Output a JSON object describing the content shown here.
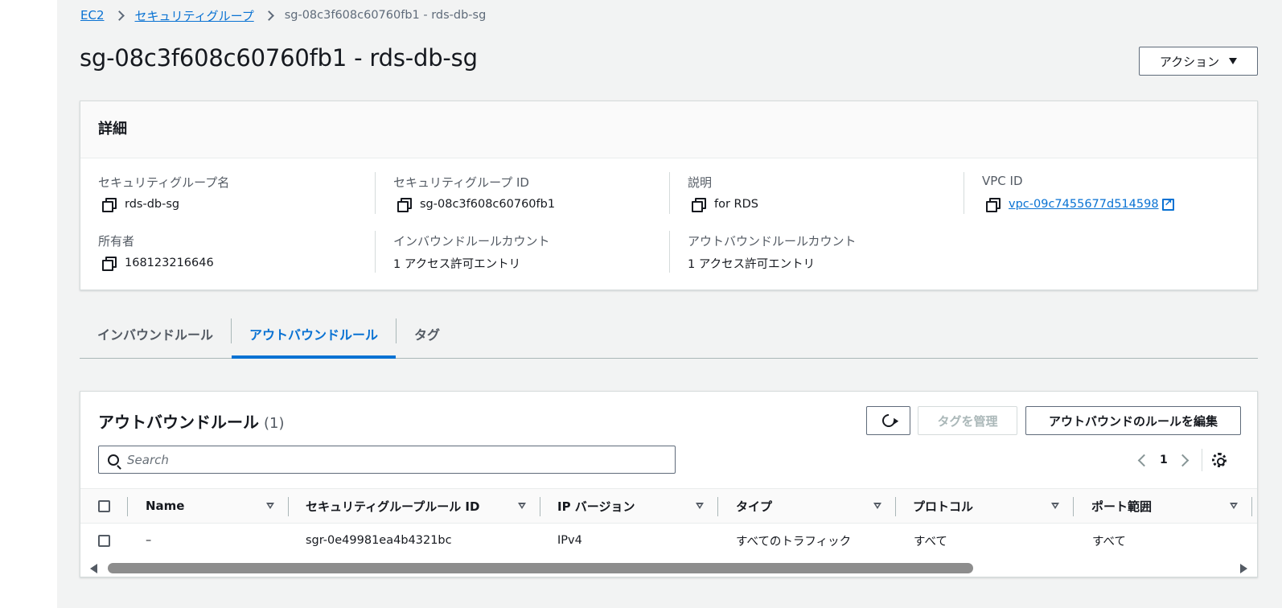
{
  "breadcrumb": {
    "items": [
      "EC2",
      "セキュリティグループ"
    ],
    "current": "sg-08c3f608c60760fb1 - rds-db-sg"
  },
  "page": {
    "title": "sg-08c3f608c60760fb1 - rds-db-sg",
    "actions_label": "アクション"
  },
  "details": {
    "header": "詳細",
    "fields": {
      "sg_name": {
        "label": "セキュリティグループ名",
        "value": "rds-db-sg"
      },
      "sg_id": {
        "label": "セキュリティグループ ID",
        "value": "sg-08c3f608c60760fb1"
      },
      "description": {
        "label": "説明",
        "value": "for RDS"
      },
      "vpc_id": {
        "label": "VPC ID",
        "value": "vpc-09c7455677d514598"
      },
      "owner": {
        "label": "所有者",
        "value": "168123216646"
      },
      "inbound_count": {
        "label": "インバウンドルールカウント",
        "value": "1 アクセス許可エントリ"
      },
      "outbound_count": {
        "label": "アウトバウンドルールカウント",
        "value": "1 アクセス許可エントリ"
      }
    }
  },
  "tabs": [
    {
      "label": "インバウンドルール",
      "active": false
    },
    {
      "label": "アウトバウンドルール",
      "active": true
    },
    {
      "label": "タグ",
      "active": false
    }
  ],
  "rules": {
    "title": "アウトバウンドルール",
    "count": "(1)",
    "manage_tags_label": "タグを管理",
    "edit_label": "アウトバウンドのルールを編集",
    "search_placeholder": "Search",
    "page_number": "1",
    "columns": [
      "Name",
      "セキュリティグループルール ID",
      "IP バージョン",
      "タイプ",
      "プロトコル",
      "ポート範囲"
    ],
    "rows": [
      [
        "–",
        "sgr-0e49981ea4b4321bc",
        "IPv4",
        "すべてのトラフィック",
        "すべて",
        "すべて"
      ]
    ]
  },
  "colors": {
    "link": "#0972d3",
    "background": "#f2f3f3",
    "active_tab": "#0972d3"
  },
  "icons": [
    "chevron-right-icon",
    "caret-down-icon",
    "copy-icon",
    "external-link-icon",
    "refresh-icon",
    "search-icon",
    "chevron-left-icon",
    "settings-gear-icon",
    "sort-icon"
  ]
}
